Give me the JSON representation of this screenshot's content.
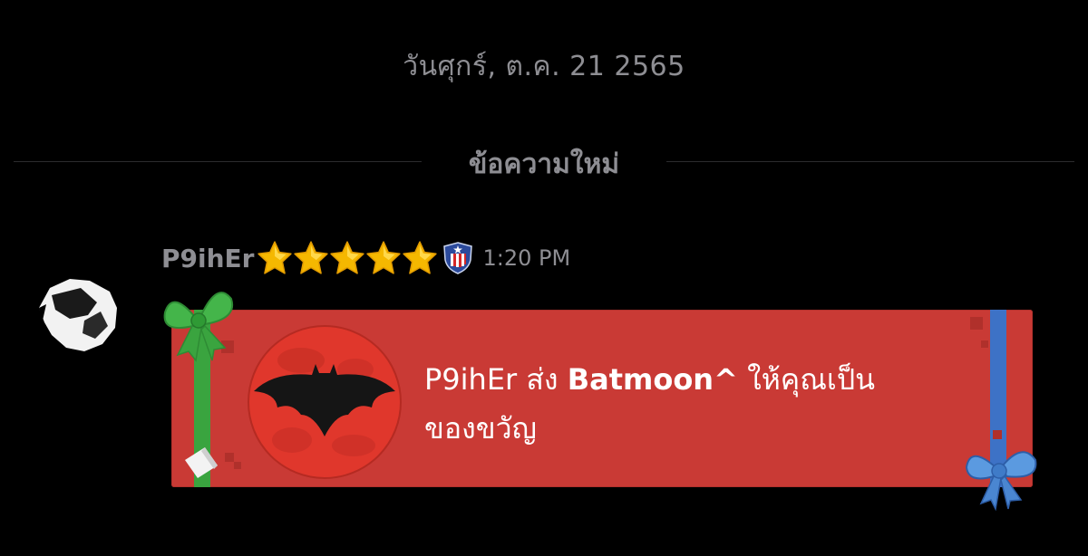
{
  "chat": {
    "date_separator": "วันศุกร์, ต.ค. 21 2565",
    "new_messages_label": "ข้อความใหม่"
  },
  "message": {
    "author": "P9ihEr",
    "star_count": 5,
    "badge_icon": "shield-flag-icon",
    "time": "1:20 PM",
    "gift": {
      "sender": "P9ihEr",
      "verb": "ส่ง",
      "item": "Batmoon^",
      "suffix_line1": "ให้คุณเป็น",
      "suffix_line2": "ของขวัญ",
      "icon": "batmoon-icon",
      "card_color": "#c93a35"
    }
  },
  "colors": {
    "background": "#000000",
    "muted_text": "#8e8e93",
    "ribbon_green": "#3aa43f",
    "ribbon_blue": "#3d72c6"
  }
}
